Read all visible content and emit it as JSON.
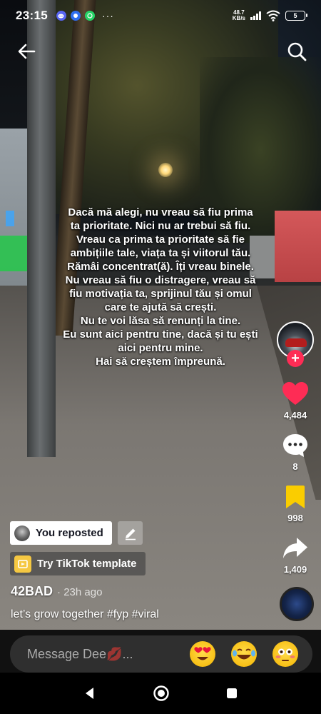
{
  "status_bar": {
    "time": "23:15",
    "net_speed_value": "48.7",
    "net_speed_unit": "KB/s",
    "battery": "5",
    "more": "···",
    "apps": [
      "discord-icon",
      "messenger-icon",
      "whatsapp-icon"
    ]
  },
  "overlay_lines": [
    "Dacă mă alegi, nu vreau să fiu prima",
    "ta prioritate. Nici nu ar trebui să fiu.",
    "Vreau ca prima ta prioritate să fie",
    "ambițiile tale, viața ta și viitorul tău.",
    "Rămâi concentrat(ă). Îți vreau binele.",
    "Nu vreau să fiu o distragere, vreau să",
    "fiu motivația ta, sprijinul tău și omul",
    "care te ajută să crești.",
    "Nu te voi lăsa să renunți la tine.",
    "Eu sunt aici pentru tine, dacă și tu ești",
    "aici pentru mine.",
    "Hai să creștem împreună."
  ],
  "rail": {
    "likes": "4,484",
    "comments": "8",
    "saves": "998",
    "shares": "1,409",
    "follow_symbol": "+"
  },
  "repost": {
    "label": "You reposted"
  },
  "template": {
    "label": "Try TikTok template"
  },
  "post": {
    "author": "42BAD",
    "time": "· 23h ago",
    "caption": "let’s grow together #fyp #viral"
  },
  "message": {
    "placeholder": "Message Dee💋..."
  },
  "colors": {
    "like": "#fe2c55",
    "save": "#facd00",
    "follow": "#fe2c55"
  }
}
